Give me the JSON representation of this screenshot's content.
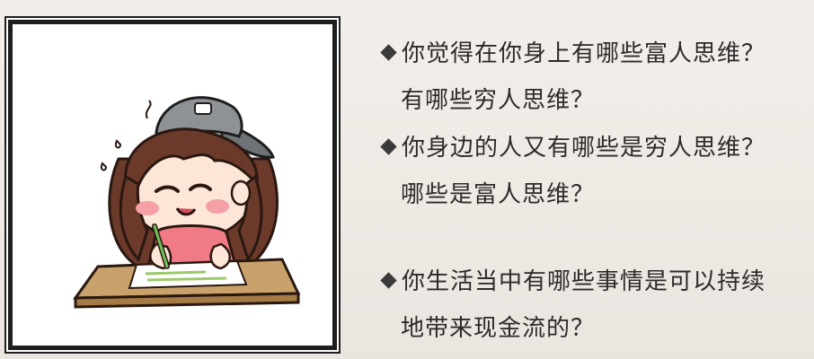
{
  "questions": [
    {
      "line1": "你觉得在你身上有哪些富人思维？",
      "line2": "有哪些穷人思维？"
    },
    {
      "line1": "你身边的人又有哪些是穷人思维？",
      "line2": "哪些是富人思维？"
    },
    {
      "line1": "你生活当中有哪些事情是可以持续",
      "line2": "地带来现金流的？"
    }
  ],
  "illustration": {
    "icon": "girl-writing-illustration",
    "frame_color": "#1e1e1e",
    "hair_color": "#6b3a2a",
    "cap_color": "#8e9196",
    "shirt_color": "#f07a86",
    "desk_color": "#c9a16a"
  },
  "colors": {
    "background": "#efe9e4",
    "text": "#2b2b2b"
  }
}
